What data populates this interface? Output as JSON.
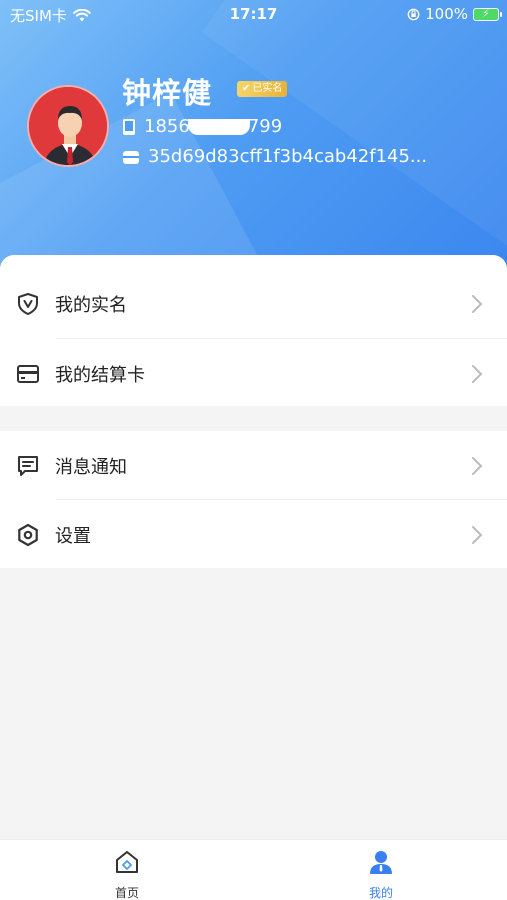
{
  "status_bar": {
    "carrier": "无SIM卡",
    "time": "17:17",
    "battery": "100%"
  },
  "profile": {
    "name": "钟梓健",
    "verified_label": "已实名",
    "phone_prefix": "1856",
    "phone_suffix": "799",
    "address": "35d69d83cff1f3b4cab42f145..."
  },
  "menu_group1": [
    {
      "label": "我的实名",
      "icon": "shield-v-icon"
    },
    {
      "label": "我的结算卡",
      "icon": "card-icon"
    }
  ],
  "menu_group2": [
    {
      "label": "消息通知",
      "icon": "message-icon"
    },
    {
      "label": "设置",
      "icon": "settings-icon"
    }
  ],
  "tabbar": {
    "home": "首页",
    "mine": "我的",
    "active": "mine",
    "active_color": "#3a7ff0"
  },
  "colors": {
    "header_gradient_start": "#7fc0f7",
    "header_gradient_end": "#3a86ef"
  }
}
